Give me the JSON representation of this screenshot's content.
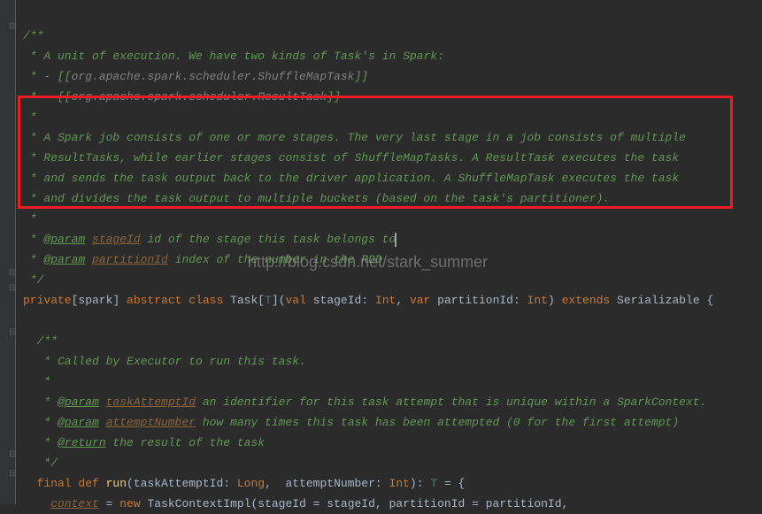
{
  "lines": {
    "l1": "/**",
    "l2": " * A unit of execution. We have two kinds of Task's in Spark:",
    "l3a": " * - [[",
    "l3b": "org.apache.spark.scheduler.ShuffleMapTask",
    "l3c": "]]",
    "l4a": " * - [[",
    "l4b": "org.apache.spark.scheduler.ResultTask",
    "l4c": "]]",
    "l5": " *",
    "l6": " * A Spark job consists of one or more stages. The very last stage in a job consists of multiple",
    "l7": " * ResultTasks, while earlier stages consist of ShuffleMapTasks. A ResultTask executes the task",
    "l8": " * and sends the task output back to the driver application. A ShuffleMapTask executes the task",
    "l9": " * and divides the task output to multiple buckets (based on the task's partitioner).",
    "l10": " *",
    "l11a": " * ",
    "l11tag": "@param",
    "l11param": "stageId",
    "l11rest": " id of the stage this task belongs to",
    "l12a": " * ",
    "l12tag": "@param",
    "l12param": "partitionId",
    "l12rest": " index of the number in the RDD",
    "l13": " */",
    "cls_private": "private",
    "cls_spark": "[spark] ",
    "cls_abstract": "abstract class ",
    "cls_task": "Task[",
    "cls_T": "T",
    "cls_brk": "](",
    "cls_val": "val ",
    "cls_stageid": "stageId: ",
    "cls_int1": "Int",
    "cls_comma": ", ",
    "cls_var": "var ",
    "cls_partid": "partitionId: ",
    "cls_int2": "Int",
    "cls_paren": ") ",
    "cls_extends": "extends ",
    "cls_serial": "Serializable {",
    "d1": "  /**",
    "d2": "   * Called by Executor to run this task.",
    "d3": "   *",
    "d4a": "   * ",
    "d4tag": "@param",
    "d4param": "taskAttemptId",
    "d4rest": " an identifier for this task attempt that is unique within a SparkContext.",
    "d5a": "   * ",
    "d5tag": "@param",
    "d5param": "attemptNumber",
    "d5rest": " how many times this task has been attempted (0 for the first attempt)",
    "d6a": "   * ",
    "d6tag": "@return",
    "d6rest": " the result of the task",
    "d7": "   */",
    "run_final": "  final def ",
    "run_name": "run",
    "run_p1": "(taskAttemptId: ",
    "run_long": "Long",
    "run_c": ",  attemptNumber: ",
    "run_int": "Int",
    "run_p2": "): ",
    "run_T": "T",
    "run_eq": " = {",
    "ctx_a": "    ",
    "ctx_context": "context",
    "ctx_eq": " = ",
    "ctx_new": "new ",
    "ctx_rest": "TaskContextImpl(stageId = stageId, partitionId = partitionId,"
  },
  "watermark": "http://blog.csdn.net/stark_summer"
}
